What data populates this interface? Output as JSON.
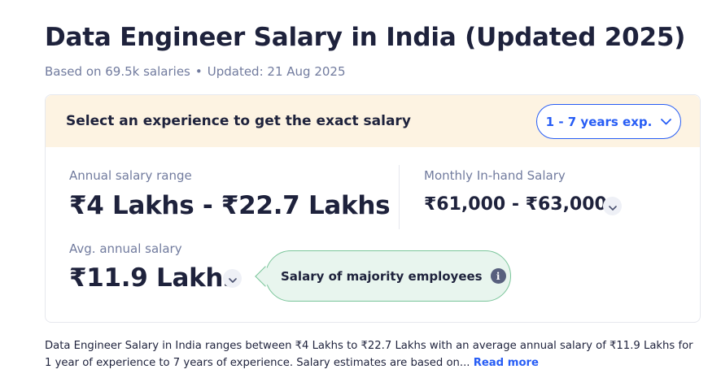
{
  "header": {
    "title": "Data Engineer Salary in India (Updated 2025)",
    "based_on": "Based on 69.5k salaries",
    "separator": "•",
    "updated": "Updated: 21 Aug 2025"
  },
  "card": {
    "prompt": "Select an experience to get the exact salary",
    "experience_select": {
      "value": "1 - 7 years exp.",
      "icon": "chevron-down-icon"
    },
    "annual_range": {
      "label": "Annual salary range",
      "value": "₹4 Lakhs - ₹22.7 Lakhs"
    },
    "monthly": {
      "label": "Monthly In-hand Salary",
      "value": "₹61,000 - ₹63,000"
    },
    "average": {
      "label": "Avg. annual salary",
      "value": "₹11.9 Lakhs"
    },
    "tooltip": {
      "text": "Salary of majority employees",
      "icon_glyph": "i"
    }
  },
  "description": {
    "text": "Data Engineer Salary in India ranges between ₹4 Lakhs to ₹22.7 Lakhs with an average annual salary of ₹11.9 Lakhs for 1 year of experience to 7 years of experience. Salary estimates are based on...",
    "read_more": "Read more"
  },
  "colors": {
    "accent": "#275df5",
    "heading": "#1e223c",
    "muted": "#717b9e",
    "card_header_bg": "#fdf3e2",
    "tooltip_bg": "#e8f5ee",
    "tooltip_border": "#7ac59a"
  }
}
